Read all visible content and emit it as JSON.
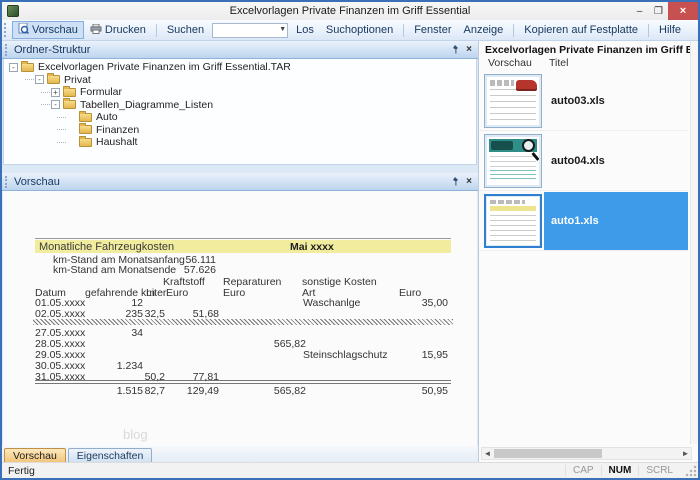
{
  "window": {
    "title": "Excelvorlagen Private Finanzen im Griff Essential",
    "minimize_glyph": "–",
    "maximize_glyph": "❐",
    "close_glyph": "×"
  },
  "toolbar": {
    "vorschau": "Vorschau",
    "drucken": "Drucken",
    "suchen": "Suchen",
    "search_value": "",
    "los": "Los",
    "suchoptionen": "Suchoptionen",
    "fenster": "Fenster",
    "anzeige": "Anzeige",
    "kopieren": "Kopieren auf Festplatte",
    "hilfe": "Hilfe"
  },
  "folder_panel": {
    "title": "Ordner-Struktur",
    "tree": [
      {
        "label": "Excelvorlagen Private Finanzen im Griff Essential.TAR",
        "level": 0,
        "expander": "-"
      },
      {
        "label": "Privat",
        "level": 1,
        "expander": "-"
      },
      {
        "label": "Formular",
        "level": 2,
        "expander": "+"
      },
      {
        "label": "Tabellen_Diagramme_Listen",
        "level": 2,
        "expander": "-"
      },
      {
        "label": "Auto",
        "level": 3,
        "expander": ""
      },
      {
        "label": "Finanzen",
        "level": 3,
        "expander": ""
      },
      {
        "label": "Haushalt",
        "level": 3,
        "expander": ""
      }
    ]
  },
  "preview_panel": {
    "title": "Vorschau",
    "watermark": "blog",
    "sheet": {
      "title": "Monatliche Fahrzeugkosten",
      "month": "Mai xxxx",
      "km_start_label": "km-Stand am Monatsanfang",
      "km_start_value": "56.111",
      "km_end_label": "km-Stand am Monatsende",
      "km_end_value": "57.626",
      "group_headers": [
        "Kraftstoff",
        "Reparaturen",
        "sonstige Kosten"
      ],
      "columns": [
        "Datum",
        "gefahrende km",
        "Liter",
        "Euro",
        "Euro",
        "Art",
        "Euro"
      ],
      "rows": [
        {
          "datum": "01.05.xxxx",
          "km": "12",
          "liter": "",
          "kraftstoff_euro": "",
          "reparaturen_euro": "",
          "art": "Waschanlge",
          "euro": "35,00"
        },
        {
          "datum": "02.05.xxxx",
          "km": "235",
          "liter": "32,5",
          "kraftstoff_euro": "51,68",
          "reparaturen_euro": "",
          "art": "",
          "euro": ""
        },
        {
          "datum": "27.05.xxxx",
          "km": "34",
          "liter": "",
          "kraftstoff_euro": "",
          "reparaturen_euro": "",
          "art": "",
          "euro": ""
        },
        {
          "datum": "28.05.xxxx",
          "km": "",
          "liter": "",
          "kraftstoff_euro": "",
          "reparaturen_euro": "565,82",
          "art": "",
          "euro": ""
        },
        {
          "datum": "29.05.xxxx",
          "km": "",
          "liter": "",
          "kraftstoff_euro": "",
          "reparaturen_euro": "",
          "art": "Steinschlagschutz",
          "euro": "15,95"
        },
        {
          "datum": "30.05.xxxx",
          "km": "1.234",
          "liter": "",
          "kraftstoff_euro": "",
          "reparaturen_euro": "",
          "art": "",
          "euro": ""
        },
        {
          "datum": "31.05.xxxx",
          "km": "",
          "liter": "50,2",
          "kraftstoff_euro": "77,81",
          "reparaturen_euro": "",
          "art": "",
          "euro": ""
        }
      ],
      "gap_after_row_index": 1,
      "totals": {
        "km": "1.515",
        "liter": "82,7",
        "kraftstoff_euro": "129,49",
        "reparaturen_euro": "565,82",
        "euro": "50,95"
      }
    }
  },
  "bottom_tabs": {
    "tabs": [
      {
        "label": "Vorschau",
        "active": true
      },
      {
        "label": "Eigenschaften",
        "active": false
      }
    ]
  },
  "file_panel": {
    "header": "Excelvorlagen Private Finanzen im Griff Essential.TAR:Pr",
    "columns": [
      "Vorschau",
      "Titel"
    ],
    "files": [
      {
        "title": "auto03.xls",
        "selected": false,
        "thumb": "car-sheet"
      },
      {
        "title": "auto04.xls",
        "selected": false,
        "thumb": "truck-magnifier-sheet"
      },
      {
        "title": "auto1.xls",
        "selected": true,
        "thumb": "yellow-sheet"
      }
    ]
  },
  "status_bar": {
    "message": "Fertig",
    "indicators": [
      {
        "label": "CAP",
        "active": false
      },
      {
        "label": "NUM",
        "active": true
      },
      {
        "label": "SCRL",
        "active": false
      }
    ]
  },
  "colors": {
    "selection_blue": "#3d9be9",
    "band_yellow": "#f1ec9e",
    "tab_active_orange": "#f2c377",
    "close_red": "#c75050",
    "window_border": "#3a70b8"
  }
}
